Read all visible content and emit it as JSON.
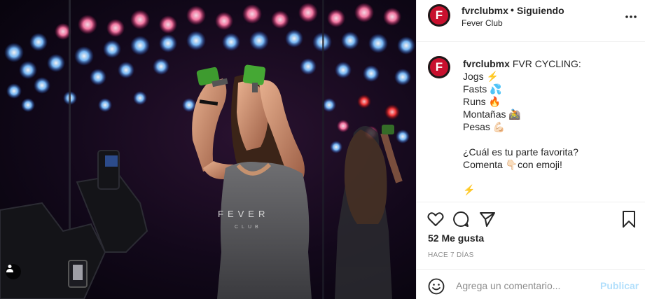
{
  "post": {
    "photo": {
      "shirt_print": "FEVER",
      "shirt_sub": "CLUB",
      "tag_icon": "user-tag-icon"
    },
    "header": {
      "username": "fvrclubmx",
      "separator": "•",
      "follow_status": "Siguiendo",
      "location": "Fever Club",
      "avatar_letter": "F",
      "more_icon": "more-horizontal-icon"
    },
    "caption": {
      "username": "fvrclubmx",
      "title": "FVR CYCLING:",
      "lines": [
        "Jogs ⚡",
        "Fasts 💦",
        "Runs 🔥",
        "Montañas 🚵",
        "Pesas 💪🏻"
      ],
      "question": "¿Cuál es tu parte favorita?",
      "cta": "Comenta 👇🏻con emoji!",
      "trailing_emoji": "⚡"
    },
    "actions": {
      "like_icon": "heart-icon",
      "comment_icon": "comment-icon",
      "share_icon": "share-icon",
      "save_icon": "bookmark-icon"
    },
    "likes": "52 Me gusta",
    "posted_ago": "HACE 7 DÍAS",
    "comment_bar": {
      "emoji_icon": "emoji-icon",
      "placeholder": "Agrega un comentario...",
      "publish_label": "Publicar"
    },
    "colors": {
      "brand_red": "#c8102e",
      "publish_disabled": "#b2dffc",
      "meta_gray": "#8e8e8e",
      "divider": "#efefef"
    }
  }
}
